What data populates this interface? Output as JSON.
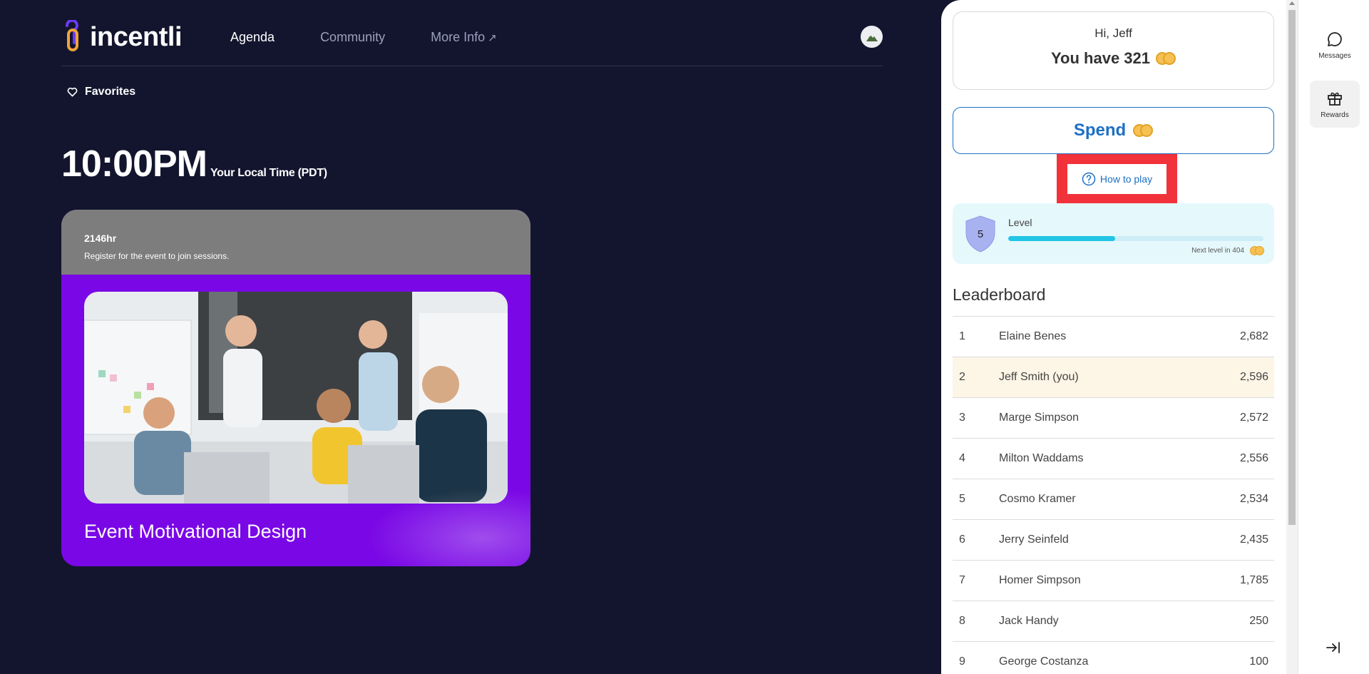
{
  "app": {
    "logo_text": "incentli",
    "nav": [
      {
        "label": "Agenda"
      },
      {
        "label": "Community"
      },
      {
        "label": "More Info"
      }
    ],
    "more_info_arrow": "↗",
    "favorites_label": "Favorites",
    "time": "10:00PM",
    "time_label": "Your Local Time (PDT)"
  },
  "event_card": {
    "hours": "2146hr",
    "note": "Register for the event to join sessions.",
    "title": "Event Motivational Design"
  },
  "panel": {
    "greeting": "Hi, Jeff",
    "balance_text": "You have 321",
    "spend_label": "Spend",
    "how_to_play_label": "How to play",
    "level_number": "5",
    "level_label": "Level",
    "level_progress_percent": 42,
    "next_level_text": "Next level in 404",
    "leaderboard_title": "Leaderboard",
    "leaderboard": [
      {
        "rank": "1",
        "name": "Elaine Benes",
        "points": "2,682"
      },
      {
        "rank": "2",
        "name": "Jeff Smith (you)",
        "points": "2,596"
      },
      {
        "rank": "3",
        "name": "Marge Simpson",
        "points": "2,572"
      },
      {
        "rank": "4",
        "name": "Milton Waddams",
        "points": "2,556"
      },
      {
        "rank": "5",
        "name": "Cosmo Kramer",
        "points": "2,534"
      },
      {
        "rank": "6",
        "name": "Jerry Seinfeld",
        "points": "2,435"
      },
      {
        "rank": "7",
        "name": "Homer Simpson",
        "points": "1,785"
      },
      {
        "rank": "8",
        "name": "Jack Handy",
        "points": "250"
      },
      {
        "rank": "9",
        "name": "George Costanza",
        "points": "100"
      }
    ]
  },
  "rail": {
    "messages_label": "Messages",
    "rewards_label": "Rewards"
  },
  "colors": {
    "background": "#13152e",
    "card_purple": "#7a08e6",
    "accent_blue": "#1d6fc4",
    "highlight_red": "#f2323a",
    "level_bar": "#22c5e5",
    "coin": "#f6c052"
  }
}
